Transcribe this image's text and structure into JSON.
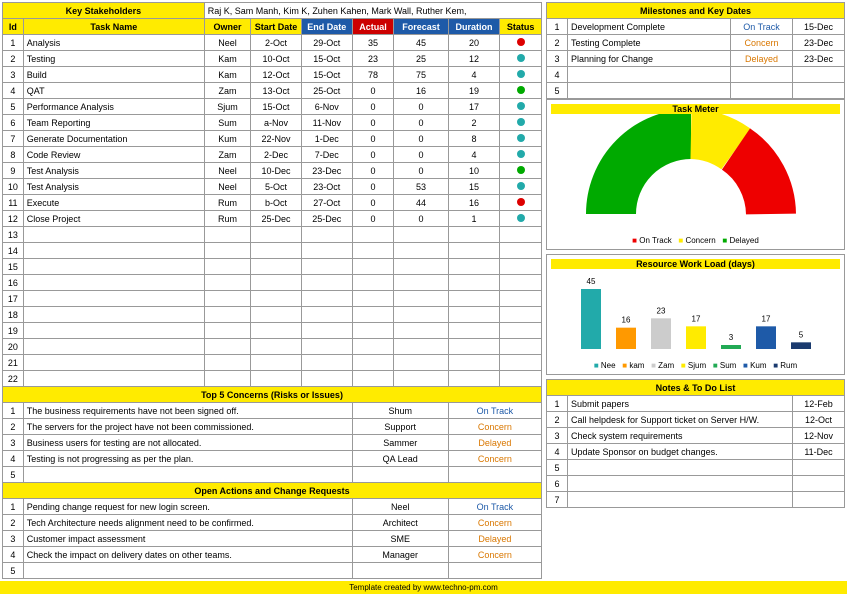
{
  "stakeholders_label": "Key Stakeholders",
  "stakeholders": "Raj K, Sam Manh, Kim K, Zuhen Kahen, Mark Wall, Ruther Kem,",
  "task_headers": {
    "id": "Id",
    "name": "Task Name",
    "owner": "Owner",
    "start": "Start Date",
    "end": "End Date",
    "actual": "Actual",
    "forecast": "Forecast",
    "duration": "Duration",
    "status": "Status"
  },
  "tasks": [
    {
      "id": "1",
      "name": "Analysis",
      "owner": "Neel",
      "start": "2-Oct",
      "end": "29-Oct",
      "actual": "35",
      "forecast": "45",
      "duration": "20",
      "dot": "d-red"
    },
    {
      "id": "2",
      "name": "Testing",
      "owner": "Kam",
      "start": "10-Oct",
      "end": "15-Oct",
      "actual": "23",
      "forecast": "25",
      "duration": "12",
      "dot": "d-teal"
    },
    {
      "id": "3",
      "name": "Build",
      "owner": "Kam",
      "start": "12-Oct",
      "end": "15-Oct",
      "actual": "78",
      "forecast": "75",
      "duration": "4",
      "dot": "d-teal"
    },
    {
      "id": "4",
      "name": "QAT",
      "owner": "Zam",
      "start": "13-Oct",
      "end": "25-Oct",
      "actual": "0",
      "forecast": "16",
      "duration": "19",
      "dot": "d-green"
    },
    {
      "id": "5",
      "name": "Performance Analysis",
      "owner": "Sjum",
      "start": "15-Oct",
      "end": "6-Nov",
      "actual": "0",
      "forecast": "0",
      "duration": "17",
      "dot": "d-teal"
    },
    {
      "id": "6",
      "name": "Team Reporting",
      "owner": "Sum",
      "start": "a-Nov",
      "end": "11-Nov",
      "actual": "0",
      "forecast": "0",
      "duration": "2",
      "dot": "d-teal"
    },
    {
      "id": "7",
      "name": "Generate Documentation",
      "owner": "Kum",
      "start": "22-Nov",
      "end": "1-Dec",
      "actual": "0",
      "forecast": "0",
      "duration": "8",
      "dot": "d-teal"
    },
    {
      "id": "8",
      "name": "Code Review",
      "owner": "Zam",
      "start": "2-Dec",
      "end": "7-Dec",
      "actual": "0",
      "forecast": "0",
      "duration": "4",
      "dot": "d-teal"
    },
    {
      "id": "9",
      "name": "Test Analysis",
      "owner": "Neel",
      "start": "10-Dec",
      "end": "23-Dec",
      "actual": "0",
      "forecast": "0",
      "duration": "10",
      "dot": "d-green"
    },
    {
      "id": "10",
      "name": "Test Analysis",
      "owner": "Neel",
      "start": "5-Oct",
      "end": "23-Oct",
      "actual": "0",
      "forecast": "53",
      "duration": "15",
      "dot": "d-teal"
    },
    {
      "id": "11",
      "name": "Execute",
      "owner": "Rum",
      "start": "b-Oct",
      "end": "27-Oct",
      "actual": "0",
      "forecast": "44",
      "duration": "16",
      "dot": "d-red"
    },
    {
      "id": "12",
      "name": "Close Project",
      "owner": "Rum",
      "start": "25-Dec",
      "end": "25-Dec",
      "actual": "0",
      "forecast": "0",
      "duration": "1",
      "dot": "d-teal"
    }
  ],
  "empty_rows": [
    "13",
    "14",
    "15",
    "16",
    "17",
    "18",
    "19",
    "20",
    "21",
    "22"
  ],
  "concerns_title": "Top 5 Concerns (Risks or Issues)",
  "concerns": [
    {
      "id": "1",
      "text": "The business requirements have not been signed off.",
      "owner": "Shum",
      "status": "On Track",
      "cls": "s-track"
    },
    {
      "id": "2",
      "text": "The servers for the project have not been commissioned.",
      "owner": "Support",
      "status": "Concern",
      "cls": "s-concern"
    },
    {
      "id": "3",
      "text": "Business users for testing are not allocated.",
      "owner": "Sammer",
      "status": "Delayed",
      "cls": "s-delayed"
    },
    {
      "id": "4",
      "text": "Testing is not progressing as per the plan.",
      "owner": "QA Lead",
      "status": "Concern",
      "cls": "s-concern"
    },
    {
      "id": "5",
      "text": "",
      "owner": "",
      "status": "",
      "cls": ""
    }
  ],
  "actions_title": "Open Actions and Change Requests",
  "actions": [
    {
      "id": "1",
      "text": "Pending change request for new login screen.",
      "owner": "Neel",
      "status": "On Track",
      "cls": "s-track"
    },
    {
      "id": "2",
      "text": "Tech Architecture needs alignment need to be confirmed.",
      "owner": "Architect",
      "status": "Concern",
      "cls": "s-concern"
    },
    {
      "id": "3",
      "text": "Customer impact assessment",
      "owner": "SME",
      "status": "Delayed",
      "cls": "s-delayed"
    },
    {
      "id": "4",
      "text": "Check the impact on delivery dates on other teams.",
      "owner": "Manager",
      "status": "Concern",
      "cls": "s-concern"
    },
    {
      "id": "5",
      "text": "",
      "owner": "",
      "status": "",
      "cls": ""
    }
  ],
  "milestones_title": "Milestones and Key Dates",
  "milestones": [
    {
      "id": "1",
      "name": "Development Complete",
      "status": "On Track",
      "cls": "s-track",
      "date": "15-Dec"
    },
    {
      "id": "2",
      "name": "Testing Complete",
      "status": "Concern",
      "cls": "s-concern",
      "date": "23-Dec"
    },
    {
      "id": "3",
      "name": "Planning for Change",
      "status": "Delayed",
      "cls": "s-delayed",
      "date": "23-Dec"
    },
    {
      "id": "4",
      "name": "",
      "status": "",
      "cls": "",
      "date": ""
    },
    {
      "id": "5",
      "name": "",
      "status": "",
      "cls": "",
      "date": ""
    }
  ],
  "task_meter_title": "Task Meter",
  "legend": {
    "track": "On Track",
    "concern": "Concern",
    "delayed": "Delayed"
  },
  "workload_title": "Resource Work Load (days)",
  "chart_data": {
    "type": "bar",
    "categories": [
      "Nee",
      "kam",
      "Zam",
      "Sjum",
      "Sum",
      "Kum",
      "Rum"
    ],
    "values": [
      45,
      16,
      23,
      17,
      3,
      17,
      5
    ],
    "colors": [
      "#2aa",
      "#f90",
      "#ccc",
      "#ffeb00",
      "#2a5",
      "#1e5aa8",
      "#1a3a6e"
    ]
  },
  "notes_title": "Notes & To Do List",
  "notes": [
    {
      "id": "1",
      "text": "Submit papers",
      "date": "12-Feb"
    },
    {
      "id": "2",
      "text": "Call helpdesk for Support ticket on Server H/W.",
      "date": "12-Oct"
    },
    {
      "id": "3",
      "text": "Check system requirements",
      "date": "12-Nov"
    },
    {
      "id": "4",
      "text": "Update Sponsor on budget changes.",
      "date": "11-Dec"
    },
    {
      "id": "5",
      "text": "",
      "date": ""
    },
    {
      "id": "6",
      "text": "",
      "date": ""
    },
    {
      "id": "7",
      "text": "",
      "date": ""
    }
  ],
  "footer": "Template created by www.techno-pm.com"
}
